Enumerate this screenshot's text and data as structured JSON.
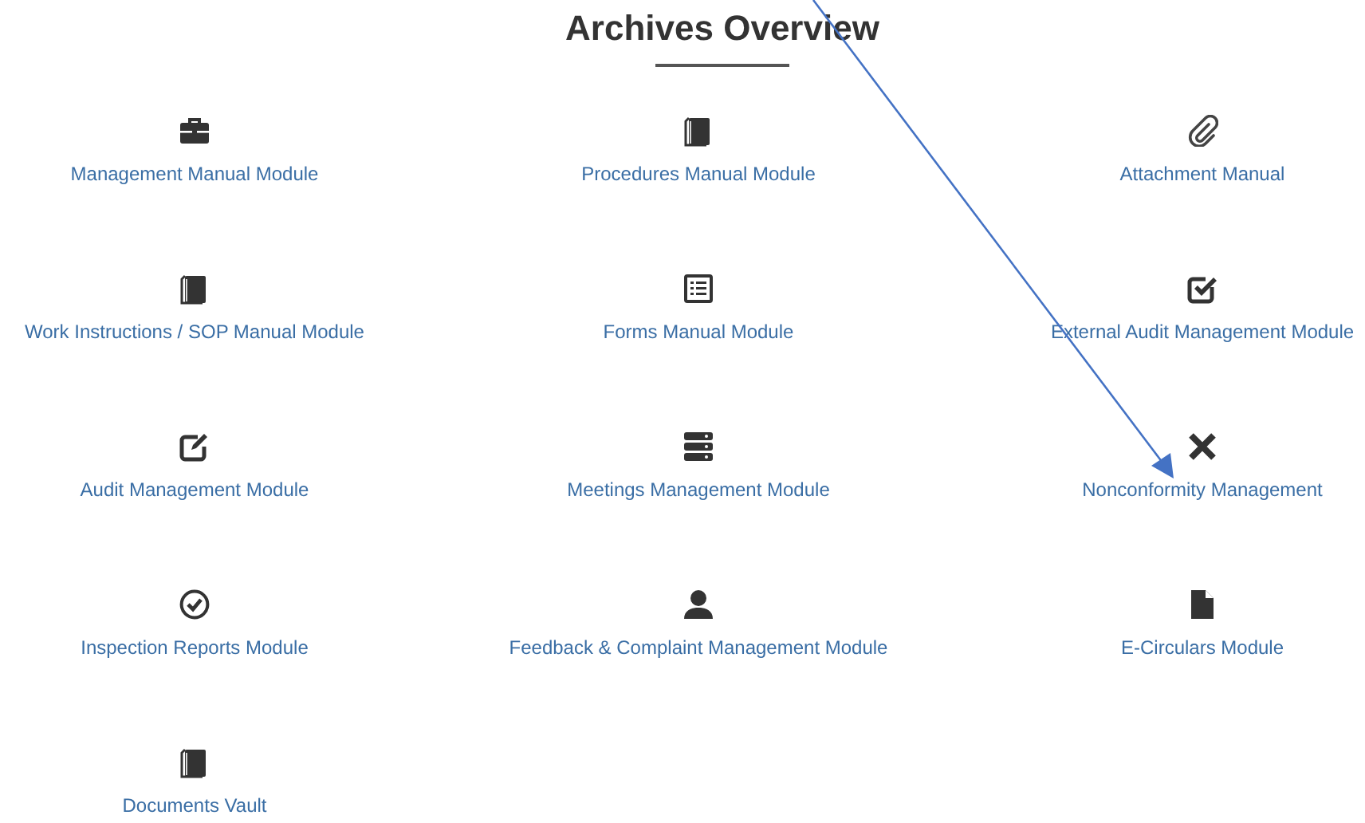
{
  "title": "Archives Overview",
  "modules": [
    {
      "label": "Management Manual Module",
      "kind": "briefcase"
    },
    {
      "label": "Procedures Manual Module",
      "kind": "book"
    },
    {
      "label": "Attachment Manual",
      "kind": "paperclip"
    },
    {
      "label": "Work Instructions / SOP Manual Module",
      "kind": "book"
    },
    {
      "label": "Forms Manual Module",
      "kind": "list"
    },
    {
      "label": "External Audit Management Module",
      "kind": "checkbox"
    },
    {
      "label": "Audit Management Module",
      "kind": "edit"
    },
    {
      "label": "Meetings Management Module",
      "kind": "server"
    },
    {
      "label": "Nonconformity Management",
      "kind": "cross"
    },
    {
      "label": "Inspection Reports Module",
      "kind": "check-circle"
    },
    {
      "label": "Feedback & Complaint Management Module",
      "kind": "user"
    },
    {
      "label": "E-Circulars Module",
      "kind": "file"
    },
    {
      "label": "Documents Vault",
      "kind": "book"
    }
  ]
}
